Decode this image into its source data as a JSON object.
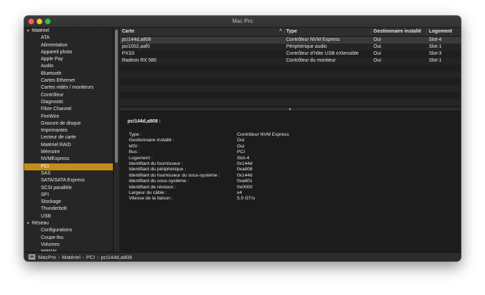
{
  "window": {
    "title": "Mac Pro"
  },
  "sidebar": {
    "groups": [
      {
        "label": "Matériel",
        "items": [
          "ATA",
          "Alimentation",
          "Appareil photo",
          "Apple Pay",
          "Audio",
          "Bluetooth",
          "Cartes Ethernet",
          "Cartes vidéo / moniteurs",
          "Contrôleur",
          "Diagnostic",
          "Fibre Channel",
          "FireWire",
          "Gravure de disque",
          "Imprimantes",
          "Lecteur de carte",
          "Matériel RAID",
          "Mémoire",
          "NVMExpress",
          "PCI",
          "SAS",
          "SATA/SATA Express",
          "SCSI parallèle",
          "SPI",
          "Stockage",
          "Thunderbolt",
          "USB"
        ]
      },
      {
        "label": "Réseau",
        "items": [
          "Configurations",
          "Coupe-feu",
          "Volumes",
          "WWAN"
        ]
      }
    ],
    "selected": "PCI"
  },
  "table": {
    "columns": [
      "Carte",
      "Type",
      "Gestionnaire installé",
      "Logement"
    ],
    "sort_indicator": "^",
    "rows": [
      [
        "pci144d,a808",
        "Contrôleur NVM Express",
        "Oui",
        "Slot-4"
      ],
      [
        "pci1002,aaf0",
        "Périphérique audio",
        "Oui",
        "Slot-1"
      ],
      [
        "PXS3",
        "Contrôleur d’hôte USB eXtensible",
        "Oui",
        "Slot-3"
      ],
      [
        "Radeon RX 580",
        "Contrôleur du moniteur",
        "Oui",
        "Slot-1"
      ]
    ]
  },
  "detail": {
    "title": "pci144d,a808 :",
    "fields": [
      [
        "Type :",
        "Contrôleur NVM Express"
      ],
      [
        "Gestionnaire installé :",
        "Oui"
      ],
      [
        "MSI :",
        "Oui"
      ],
      [
        "Bus :",
        "PCI"
      ],
      [
        "Logement :",
        "Slot-4"
      ],
      [
        "Identifiant du fournisseur :",
        "0x144d"
      ],
      [
        "Identifiant du périphérique :",
        "0xa808"
      ],
      [
        "Identifiant du fournisseur du sous-système :",
        "0x144d"
      ],
      [
        "Identifiant du sous-système :",
        "0xa801"
      ],
      [
        "Identifiant de révision :",
        "0x0000"
      ],
      [
        "Largeur du câble :",
        "x4"
      ],
      [
        "Vitesse de la liaison :",
        "5.0 GT/s"
      ]
    ]
  },
  "statusbar": {
    "path": [
      "MacPro",
      "Matériel",
      "PCI",
      "pci144d,a808"
    ],
    "separator": "›"
  },
  "colors": {
    "selection": "#c48d1a",
    "window_bg": "#1f1f1f"
  }
}
